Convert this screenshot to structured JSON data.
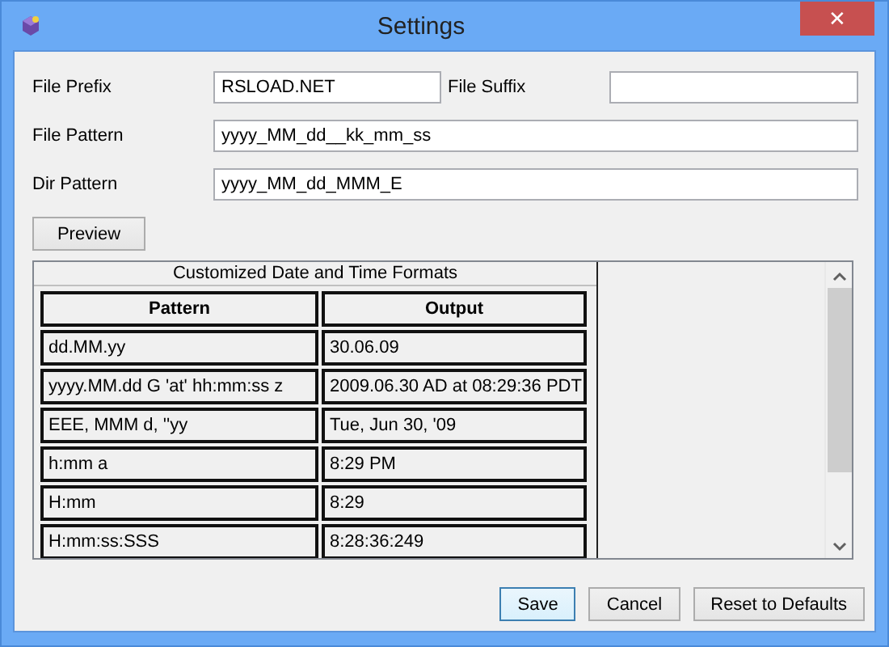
{
  "window": {
    "title": "Settings",
    "close": "✕"
  },
  "fields": [
    {
      "label": "File Prefix",
      "value": "RSLOAD.NET"
    },
    {
      "label": "File Suffix"
    },
    {
      "label": "File Pattern",
      "value": "yyyy_MM_dd__kk_mm_ss"
    },
    {
      "label": "Dir Pattern",
      "value": "yyyy_MM_dd_MMM_E"
    }
  ],
  "preview_button": "Preview",
  "formats": {
    "title": "Customized Date and Time Formats",
    "columns": [
      "Pattern",
      "Output"
    ],
    "rows": [
      [
        "dd.MM.yy",
        "30.06.09"
      ],
      [
        "yyyy.MM.dd G 'at' hh:mm:ss z",
        "2009.06.30 AD at 08:29:36 PDT"
      ],
      [
        "EEE, MMM d, ''yy",
        "Tue, Jun 30, '09"
      ],
      [
        "h:mm a",
        "8:29 PM"
      ],
      [
        "H:mm",
        "8:29"
      ],
      [
        "H:mm:ss:SSS",
        "8:28:36:249"
      ]
    ]
  },
  "buttons": [
    {
      "label": "Save",
      "selected": true
    },
    {
      "label": "Cancel",
      "selected": false
    },
    {
      "label": "Reset to Defaults",
      "selected": false
    }
  ]
}
